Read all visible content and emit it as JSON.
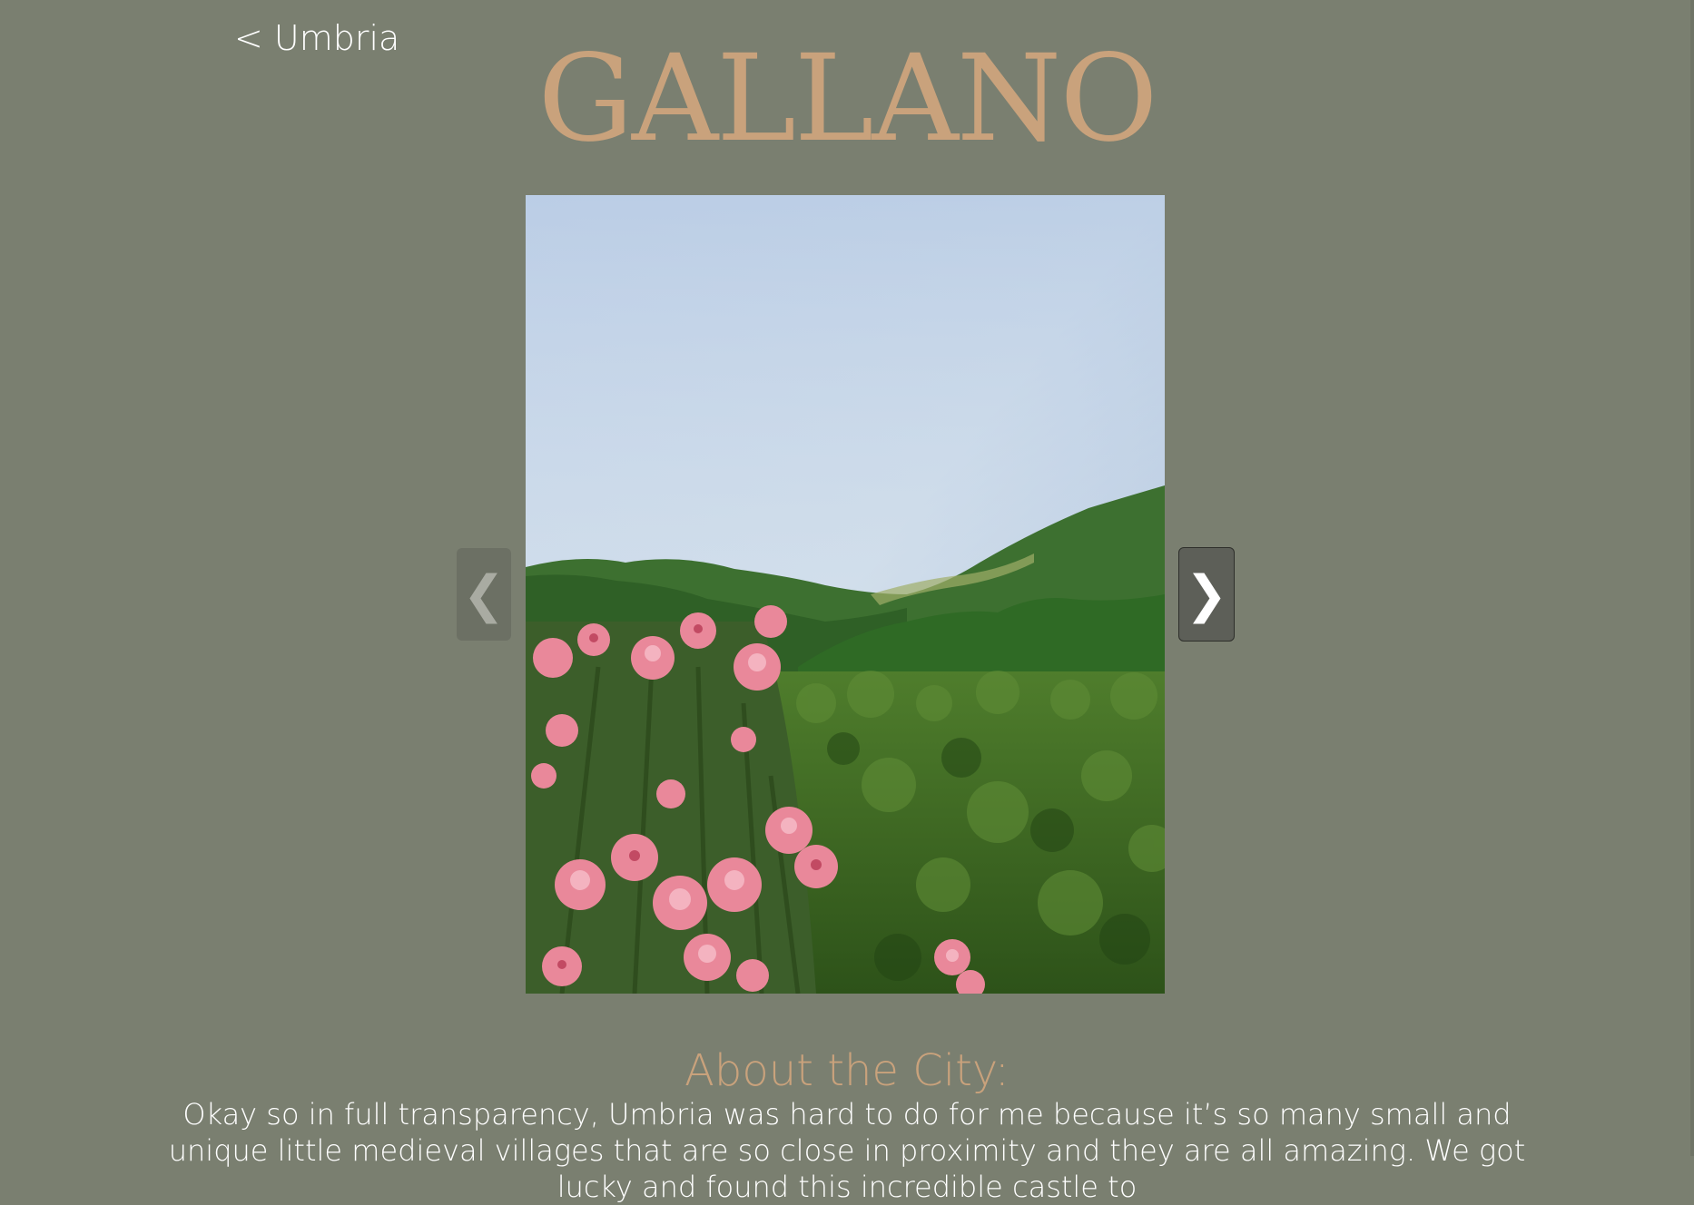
{
  "nav": {
    "back_label": "< Umbria"
  },
  "header": {
    "title": "GALLANO"
  },
  "gallery": {
    "prev_label": "❮",
    "next_label": "❯",
    "image_alt": "Pink oleander flowers in front of green Umbrian hills under a pale blue sky"
  },
  "about": {
    "heading": "About the City:",
    "text": "Okay so in full transparency, Umbria was hard to do for me because it’s so many small and unique little medieval villages that are so close in proximity and they are all amazing. We got lucky and found this incredible castle to"
  },
  "colors": {
    "background": "#7a7f70",
    "accent": "#c9a27c",
    "text": "#ffffff"
  }
}
